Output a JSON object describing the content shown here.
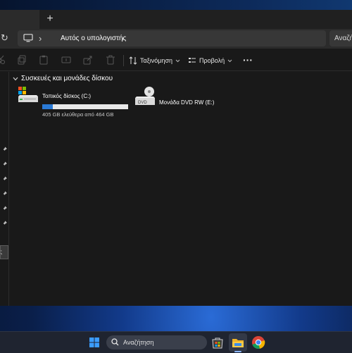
{
  "window": {
    "new_tab_symbol": "+",
    "refresh_symbol": "↻",
    "address": {
      "separator_symbol": "›",
      "breadcrumb": "Αυτός ο υπολογιστής"
    },
    "search_placeholder": "Αναζήτηση"
  },
  "toolbar": {
    "sort_label": "Ταξινόμηση",
    "view_label": "Προβολή",
    "more_symbol": "···"
  },
  "content": {
    "group_title": "Συσκευές και μονάδες δίσκου",
    "drives": [
      {
        "name": "Τοπικός δίσκος (C:)",
        "space": "405 GB ελεύθερα από 464 GB",
        "used_fraction": 0.127,
        "icon": "hard-drive-icon"
      },
      {
        "name": "Μονάδα DVD RW (E:)",
        "icon": "dvd-drive-icon",
        "icon_label": "DVD"
      }
    ]
  },
  "nav_pane": {
    "selected_item_fragment": "ς"
  },
  "taskbar": {
    "search_placeholder": "Αναζήτηση",
    "apps": [
      "store-icon",
      "file-explorer-icon",
      "chrome-icon"
    ]
  },
  "colors": {
    "accent": "#2a7ad6",
    "window_bg": "#191919",
    "taskbar_bg": "#1f2430"
  }
}
